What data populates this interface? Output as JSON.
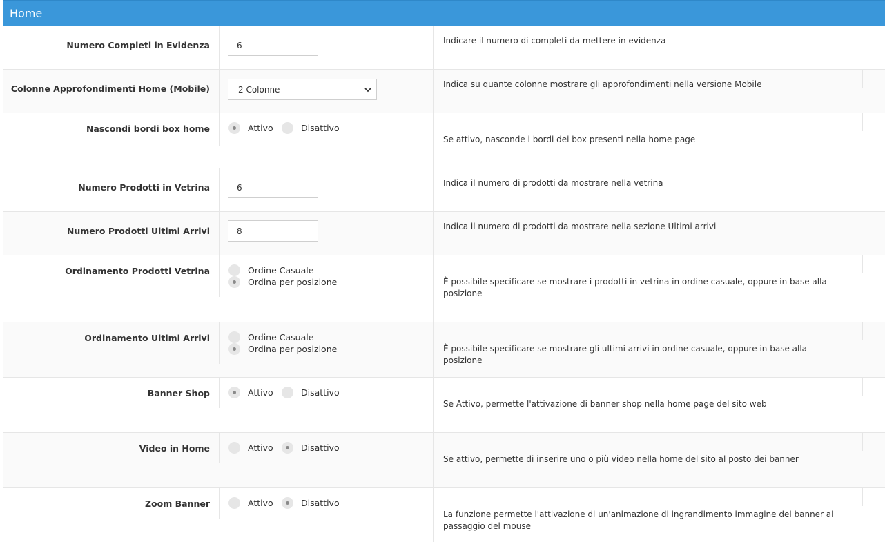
{
  "panel": {
    "title": "Home"
  },
  "rows": [
    {
      "label": "Numero Completi in Evidenza",
      "type": "text",
      "value": "6",
      "description": "Indicare il numero di completi da mettere in evidenza"
    },
    {
      "label": "Colonne Approfondimenti Home (Mobile)",
      "type": "select",
      "value": "2 Colonne",
      "description": "Indica su quante colonne mostrare gli approfondimenti nella versione Mobile"
    },
    {
      "label": "Nascondi bordi box home",
      "type": "radio",
      "options": [
        "Attivo",
        "Disattivo"
      ],
      "selected": "Attivo",
      "description": "Se attivo, nasconde i bordi dei box presenti nella home page"
    },
    {
      "label": "Numero Prodotti in Vetrina",
      "type": "text",
      "value": "6",
      "description": "Indica il numero di prodotti da mostrare nella vetrina"
    },
    {
      "label": "Numero Prodotti Ultimi Arrivi",
      "type": "text",
      "value": "8",
      "description": "Indica il numero di prodotti da mostrare nella sezione Ultimi arrivi"
    },
    {
      "label": "Ordinamento Prodotti Vetrina",
      "type": "radio",
      "options": [
        "Ordine Casuale",
        "Ordina per posizione"
      ],
      "selected": "Ordina per posizione",
      "description": "È possibile specificare se mostrare i prodotti in vetrina in ordine casuale, oppure in base alla posizione"
    },
    {
      "label": "Ordinamento Ultimi Arrivi",
      "type": "radio",
      "options": [
        "Ordine Casuale",
        "Ordina per posizione"
      ],
      "selected": "Ordina per posizione",
      "description": "È possibile specificare se mostrare gli ultimi arrivi in ordine casuale, oppure in base alla posizione"
    },
    {
      "label": "Banner Shop",
      "type": "radio",
      "options": [
        "Attivo",
        "Disattivo"
      ],
      "selected": "Attivo",
      "description": "Se Attivo, permette l'attivazione di banner shop nella home page del sito web"
    },
    {
      "label": "Video in Home",
      "type": "radio",
      "options": [
        "Attivo",
        "Disattivo"
      ],
      "selected": "Disattivo",
      "description": "Se attivo, permette di inserire uno o più video nella home del sito al posto dei banner"
    },
    {
      "label": "Zoom Banner",
      "type": "radio",
      "options": [
        "Attivo",
        "Disattivo"
      ],
      "selected": "Disattivo",
      "description": "La funzione permette l'attivazione di un'animazione di ingrandimento immagine del banner al passaggio del mouse"
    }
  ]
}
